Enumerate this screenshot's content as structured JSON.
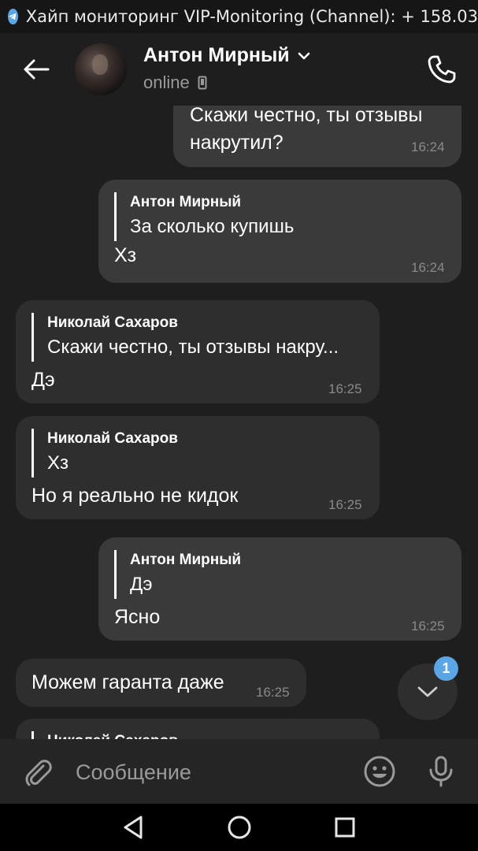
{
  "status_bar": {
    "notification": "Хайп мониторинг VIP-Monitoring (Channel): + 158.03"
  },
  "header": {
    "name": "Антон Мирный",
    "status": "online"
  },
  "messages": [
    {
      "direction": "out",
      "text_line1": "Скажи честно, ты отзывы",
      "text_line2": "накрутил?",
      "time": "16:24"
    },
    {
      "direction": "out",
      "reply_name": "Антон Мирный",
      "reply_text": "За сколько купишь",
      "text": "Хз",
      "time": "16:24"
    },
    {
      "direction": "in",
      "reply_name": "Николай Сахаров",
      "reply_text": "Скажи честно, ты отзывы накру...",
      "text": "Дэ",
      "time": "16:25"
    },
    {
      "direction": "in",
      "reply_name": "Николай Сахаров",
      "reply_text": "Хз",
      "text": "Но я реально не кидок",
      "time": "16:25"
    },
    {
      "direction": "out",
      "reply_name": "Антон Мирный",
      "reply_text": "Дэ",
      "text": "Ясно",
      "time": "16:25"
    },
    {
      "direction": "in",
      "text": "Можем гаранта даже",
      "time": "16:25"
    },
    {
      "direction": "in",
      "reply_name": "Николай Сахаров"
    }
  ],
  "scroll_down": {
    "unread_count": "1"
  },
  "composer": {
    "placeholder": "Сообщение"
  },
  "icons": {
    "telegram": "telegram-icon",
    "back": "arrow-left-icon",
    "dropdown": "chevron-down-icon",
    "device": "phone-device-icon",
    "call": "phone-call-icon",
    "scroll_down": "chevron-down-icon",
    "attach": "paperclip-icon",
    "emoji": "smiley-icon",
    "mic": "microphone-icon",
    "nav_back": "triangle-back-icon",
    "nav_home": "circle-home-icon",
    "nav_recents": "square-recents-icon"
  },
  "colors": {
    "background": "#1e1e1e",
    "bubble_out": "#3a3a3a",
    "bubble_in": "#2e2e2e",
    "accent": "#5aa5e6",
    "timestamp": "#8a8a8a"
  }
}
